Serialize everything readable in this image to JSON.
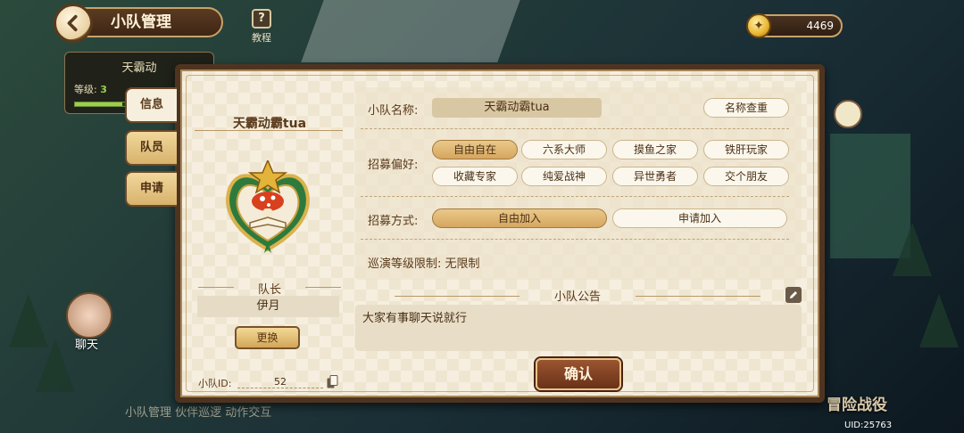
{
  "header": {
    "title": "小队管理",
    "tutorial_label": "教程",
    "tutorial_glyph": "?"
  },
  "currency": {
    "amount": "4469"
  },
  "background": {
    "card_name": "天霸动",
    "card_level_label": "等级:",
    "card_level_value": "3",
    "chat_label": "聊天",
    "bottom_text": "小队管理  伙伴巡逻  动作交互",
    "campaign_label": "冒险战役",
    "uid_text": "UID:25763"
  },
  "tabs": [
    {
      "label": "信息",
      "active": true
    },
    {
      "label": "队员",
      "active": false
    },
    {
      "label": "申请",
      "active": false
    }
  ],
  "team": {
    "name": "天霸动霸tua",
    "captain_label": "队长",
    "captain_name": "伊月",
    "change_button": "更换",
    "id_label": "小队ID:",
    "id_value": "52"
  },
  "form": {
    "name_label": "小队名称:",
    "name_value": "天霸动霸tua",
    "name_check_button": "名称查重",
    "preference_label": "招募偏好:",
    "preferences": [
      {
        "label": "自由自在",
        "selected": true
      },
      {
        "label": "六系大师",
        "selected": false
      },
      {
        "label": "摸鱼之家",
        "selected": false
      },
      {
        "label": "铁肝玩家",
        "selected": false
      },
      {
        "label": "收藏专家",
        "selected": false
      },
      {
        "label": "纯爱战神",
        "selected": false
      },
      {
        "label": "异世勇者",
        "selected": false
      },
      {
        "label": "交个朋友",
        "selected": false
      }
    ],
    "recruit_label": "招募方式:",
    "recruit_options": [
      {
        "label": "自由加入",
        "selected": true
      },
      {
        "label": "申请加入",
        "selected": false
      }
    ],
    "level_limit_label": "巡演等级限制:",
    "level_limit_value": "无限制"
  },
  "notice": {
    "title": "小队公告",
    "content": "大家有事聊天说就行"
  },
  "confirm_button": "确认",
  "colors": {
    "panel_border": "#4e3420",
    "selected_pill": "#d5a660",
    "confirm": "#6a3118"
  }
}
